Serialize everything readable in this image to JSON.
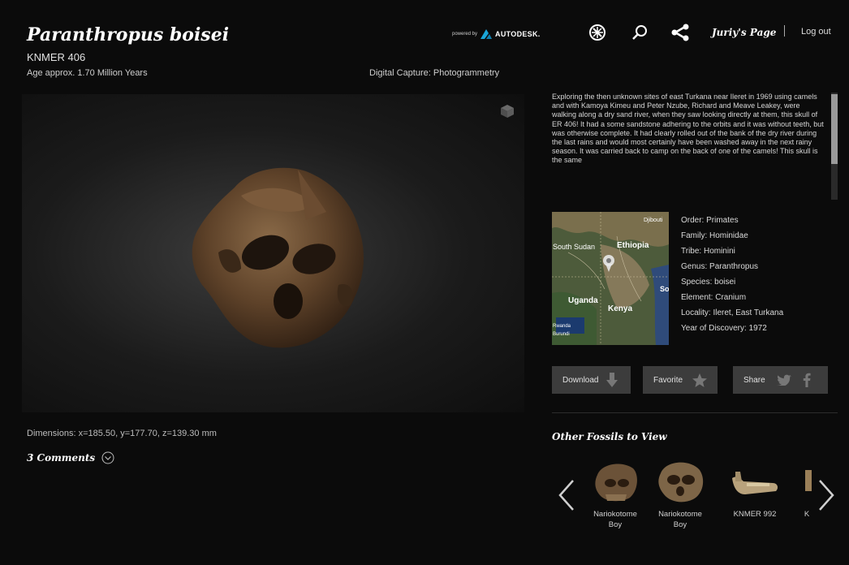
{
  "header": {
    "title": "Paranthropus boisei",
    "specimen": "KNMER 406",
    "age": "Age approx. 1.70 Million Years",
    "capture": "Digital Capture: Photogrammetry",
    "powered_by": "powered by",
    "brand": "AUTODESK.",
    "user_link": "Juriy's Page",
    "logout": "Log out",
    "icons": [
      "settings-icon",
      "search-icon",
      "share-icon"
    ]
  },
  "viewer": {
    "dimensions": "Dimensions: x=185.50, y=177.70, z=139.30 mm",
    "comments": "3 Comments"
  },
  "description": "Exploring the then unknown sites of east Turkana near Ileret in 1969 using camels and with Kamoya Kimeu and Peter Nzube, Richard and Meave Leakey, were walking along a dry sand river, when they saw looking directly at them, this skull of ER 406! It had a some sandstone adhering to the orbits and it was without teeth, but was otherwise complete. It had clearly rolled out of the bank of the dry river during the last rains and would most certainly have been washed away in the next rainy season. It was carried back to camp on the back of one of the camels! This skull is the same",
  "map": {
    "labels": [
      "Djibouti",
      "Ethiopia",
      "South Sudan",
      "Uganda",
      "Kenya",
      "Rwanda",
      "Burundi",
      "So"
    ]
  },
  "taxonomy": [
    "Order: Primates",
    "Family: Hominidae",
    "Tribe: Hominini",
    "Genus: Paranthropus",
    "Species: boisei",
    "Element: Cranium",
    "Locality: Ileret, East Turkana",
    "Year of Discovery: 1972"
  ],
  "actions": {
    "download": "Download",
    "favorite": "Favorite",
    "share": "Share"
  },
  "other_fossils": {
    "title": "Other Fossils to View",
    "items": [
      {
        "line1": "Nariokotome",
        "line2": "Boy"
      },
      {
        "line1": "Nariokotome",
        "line2": "Boy"
      },
      {
        "line1": "KNMER 992",
        "line2": ""
      },
      {
        "line1": "K",
        "line2": ""
      }
    ]
  },
  "colors": {
    "background": "#0b0b0b",
    "button": "#3c3c3c",
    "autodesk_logo": "#19a5d8"
  }
}
